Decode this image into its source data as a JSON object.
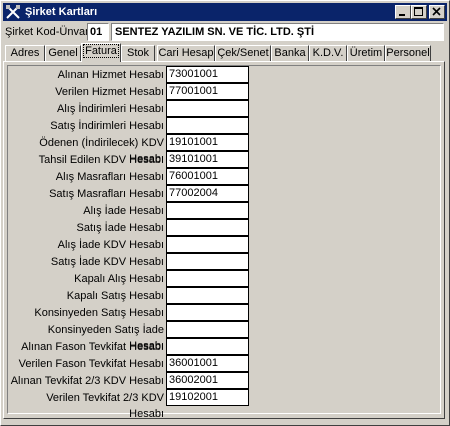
{
  "window": {
    "title": "Şirket Kartları"
  },
  "header": {
    "code_label": "Şirket Kod-Ünvanı",
    "code_value": "01",
    "name_value": "SENTEZ YAZILIM SN. VE TİC. LTD. ŞTİ"
  },
  "tabs": [
    {
      "label": "Adres"
    },
    {
      "label": "Genel"
    },
    {
      "label": "Fatura"
    },
    {
      "label": "Stok"
    },
    {
      "label": "Cari Hesap"
    },
    {
      "label": "Çek/Senet"
    },
    {
      "label": "Banka"
    },
    {
      "label": "K.D.V."
    },
    {
      "label": "Üretim"
    },
    {
      "label": "Personel"
    }
  ],
  "fields": [
    {
      "label": "Alınan Hizmet Hesabı",
      "value": "73001001"
    },
    {
      "label": "Verilen Hizmet Hesabı",
      "value": "77001001"
    },
    {
      "label": "Alış İndirimleri Hesabı",
      "value": ""
    },
    {
      "label": "Satış İndirimleri Hesabı",
      "value": ""
    },
    {
      "label": "Ödenen (İndirilecek) KDV Hesabı",
      "value": "19101001"
    },
    {
      "label": "Tahsil Edilen KDV Hesabı",
      "value": "39101001"
    },
    {
      "label": "Alış Masrafları Hesabı",
      "value": "76001001"
    },
    {
      "label": "Satış Masrafları Hesabı",
      "value": "77002004"
    },
    {
      "label": "Alış İade Hesabı",
      "value": ""
    },
    {
      "label": "Satış İade Hesabı",
      "value": ""
    },
    {
      "label": "Alış İade KDV Hesabı",
      "value": ""
    },
    {
      "label": "Satış İade KDV Hesabı",
      "value": ""
    },
    {
      "label": "Kapalı Alış Hesabı",
      "value": ""
    },
    {
      "label": "Kapalı Satış Hesabı",
      "value": ""
    },
    {
      "label": "Konsinyeden Satış Hesabı",
      "value": ""
    },
    {
      "label": "Konsinyeden Satış İade Hesabı",
      "value": ""
    },
    {
      "label": "Alınan Fason Tevkifat Hesabı",
      "value": ""
    },
    {
      "label": "Verilen Fason Tevkifat Hesabı",
      "value": "36001001"
    },
    {
      "label": "Alınan Tevkifat 2/3 KDV Hesabı",
      "value": "36002001"
    },
    {
      "label": "Verilen Tevkifat 2/3 KDV Hesabı",
      "value": "19102001"
    }
  ]
}
